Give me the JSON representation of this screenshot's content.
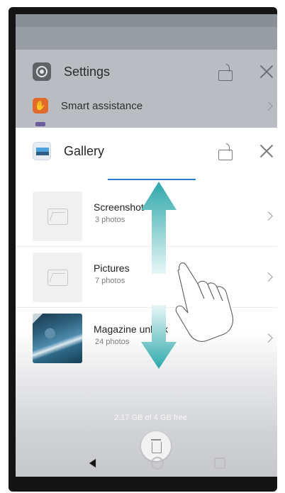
{
  "recents": {
    "settings": {
      "title": "Settings",
      "row_label": "Smart assistance"
    },
    "gallery": {
      "title": "Gallery",
      "albums": [
        {
          "name": "Screenshot",
          "count": "3 photos"
        },
        {
          "name": "Pictures",
          "count": "7 photos"
        },
        {
          "name": "Magazine unlock",
          "count": "24 photos"
        }
      ],
      "storage_text": "2.17 GB of 4 GB free"
    }
  },
  "icons": {
    "settings": "settings-icon",
    "smart_assistance": "hand-icon",
    "gallery": "gallery-icon",
    "lock": "lock-icon",
    "close": "close-icon",
    "trash": "trash-icon",
    "nav_back": "back-icon",
    "nav_home": "home-icon",
    "nav_recent": "recent-apps-icon",
    "gesture": "hand-gesture-icon",
    "arrows": "double-arrow-icon"
  },
  "colors": {
    "accent_blue": "#2b7cd3",
    "arrow_teal": "#2ea8ab",
    "settings_orange": "#e06a2b"
  }
}
